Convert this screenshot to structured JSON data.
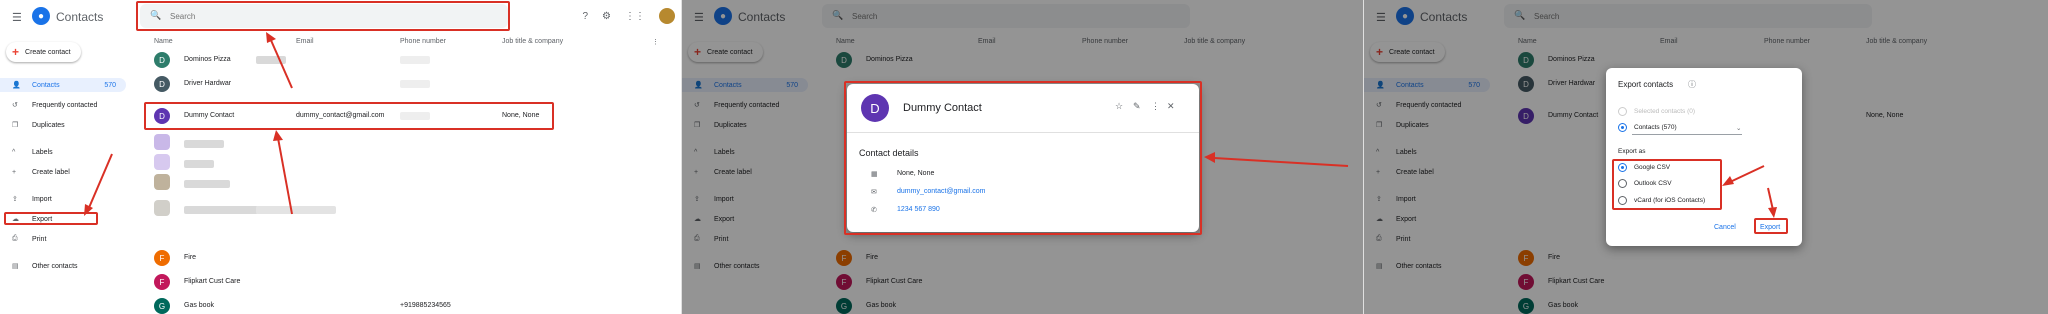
{
  "app": {
    "title": "Contacts",
    "logo_letter": "👤",
    "search_placeholder": "Search",
    "create_label": "Create contact"
  },
  "nav": {
    "items": [
      {
        "label": "Contacts",
        "count": "570",
        "icon": "person-icon"
      },
      {
        "label": "Frequently contacted",
        "icon": "history-icon"
      },
      {
        "label": "Duplicates",
        "icon": "copy-icon"
      }
    ],
    "labels_header": "Labels",
    "create_label": "Create label",
    "import": "Import",
    "export": "Export",
    "print": "Print",
    "other": "Other contacts"
  },
  "table": {
    "headers": [
      "Name",
      "Email",
      "Phone number",
      "Job title & company"
    ],
    "rows": [
      {
        "initial": "D",
        "name": "Dominos Pizza",
        "color": "#2e7d6b"
      },
      {
        "initial": "D",
        "name": "Driver Hardwar",
        "color": "#455a64"
      },
      {
        "initial": "D",
        "name": "Dummy Contact",
        "email": "dummy_contact@gmail.com",
        "job": "None, None",
        "color": "#5e35b1"
      },
      {
        "initial": "F",
        "name": "Fire",
        "color": "#ef6c00"
      },
      {
        "initial": "F",
        "name": "Flipkart Cust Care",
        "color": "#c2185b"
      },
      {
        "initial": "G",
        "name": "Gas book",
        "phone": "+919885234565",
        "color": "#00695c"
      }
    ]
  },
  "contact_dialog": {
    "initial": "D",
    "name": "Dummy Contact",
    "section": "Contact details",
    "job": "None, None",
    "email": "dummy_contact@gmail.com",
    "phone": "1234 567 890"
  },
  "export_dialog": {
    "title": "Export contacts",
    "opt_selected": "Selected contacts (0)",
    "opt_contacts": "Contacts (570)",
    "export_as": "Export as",
    "formats": [
      "Google CSV",
      "Outlook CSV",
      "vCard (for iOS Contacts)"
    ],
    "cancel": "Cancel",
    "export": "Export"
  },
  "colors": {
    "accent": "#1a73e8",
    "annotation": "#d93025"
  }
}
